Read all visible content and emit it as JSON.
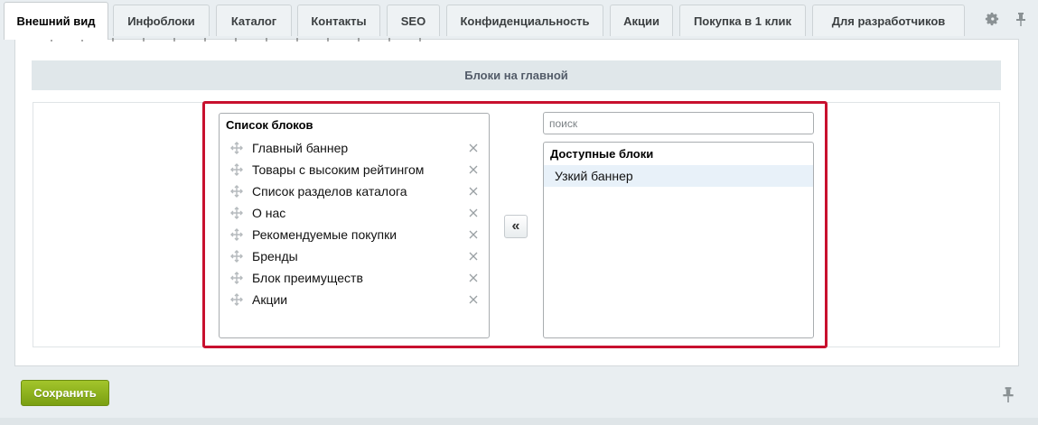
{
  "tabs": [
    {
      "label": "Внешний вид",
      "active": true
    },
    {
      "label": "Инфоблоки",
      "active": false
    },
    {
      "label": "Каталог",
      "active": false
    },
    {
      "label": "Контакты",
      "active": false
    },
    {
      "label": "SEO",
      "active": false
    },
    {
      "label": "Конфиденциальность",
      "active": false
    },
    {
      "label": "Акции",
      "active": false
    },
    {
      "label": "Покупка в 1 клик",
      "active": false
    },
    {
      "label": "Для разработчиков",
      "active": false
    }
  ],
  "tabbar_icons": [
    "gear-icon",
    "pin-icon"
  ],
  "section": {
    "title": "Блоки на главной"
  },
  "blocks_list": {
    "title": "Список блоков",
    "items": [
      "Главный баннер",
      "Товары с высоким рейтингом",
      "Список разделов каталога",
      "О нас",
      "Рекомендуемые покупки",
      "Бренды",
      "Блок преимуществ",
      "Акции"
    ]
  },
  "move_button": {
    "label": "«"
  },
  "search": {
    "placeholder": "поиск",
    "value": ""
  },
  "available_list": {
    "title": "Доступные блоки",
    "items": [
      "Узкий баннер"
    ]
  },
  "footer": {
    "save_label": "Сохранить"
  },
  "colors": {
    "highlight_border": "#c8102e",
    "save_button": "#8db21d",
    "section_header_bg": "#e0e7ea",
    "selected_item_bg": "#e8f1f9"
  }
}
